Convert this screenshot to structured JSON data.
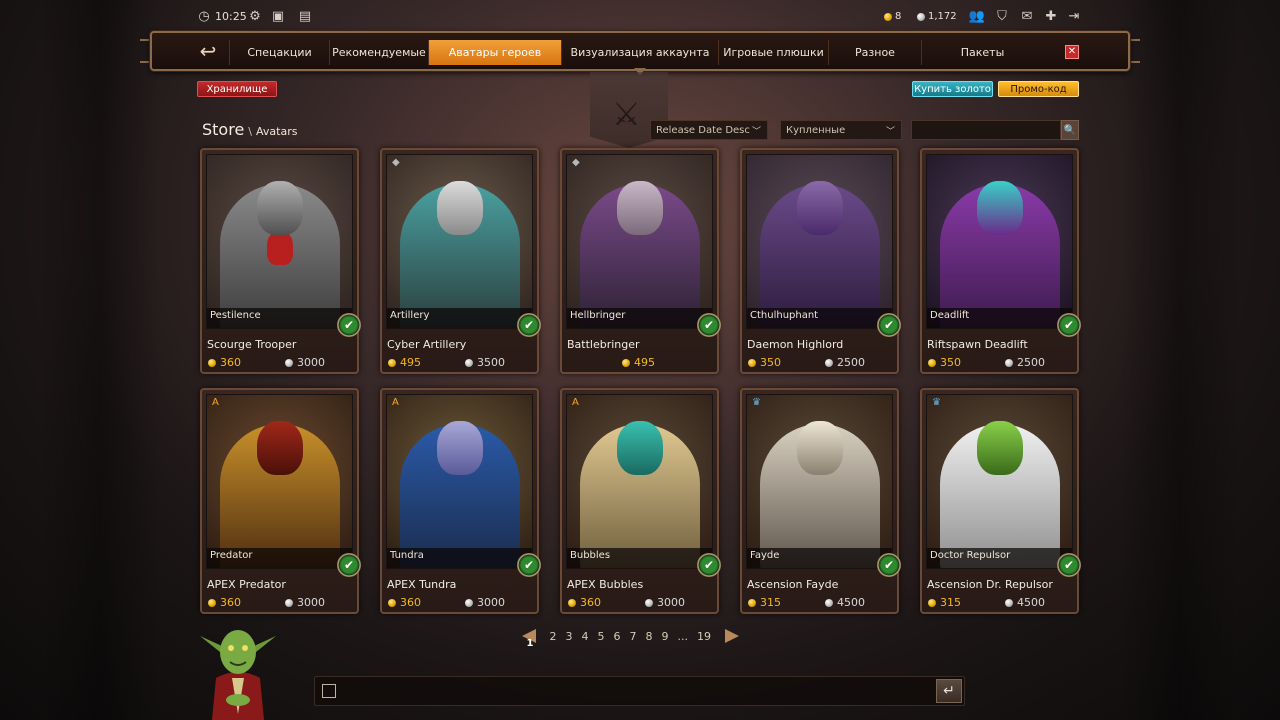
{
  "topbar": {
    "time": "10:25",
    "gold": "8",
    "silver": "1,172",
    "left_icons": [
      "clock-icon",
      "settings-gear-icon",
      "camera-icon",
      "notes-icon"
    ],
    "right_icons": [
      "friends-icon",
      "shield-icon",
      "mail-icon",
      "add-friend-icon",
      "logout-icon"
    ]
  },
  "nav": {
    "tabs": [
      {
        "label": "Спецакции"
      },
      {
        "label": "Рекомендуемые"
      },
      {
        "label": "Аватары героев"
      },
      {
        "label": "Визуализация аккаунта"
      },
      {
        "label": "Игровые плюшки"
      },
      {
        "label": "Разное"
      },
      {
        "label": "Пакеты"
      }
    ],
    "active_tab": "Аватары героев",
    "close": "✕",
    "back": "↩"
  },
  "buttons": {
    "storage": "Хранилище",
    "buy_gold": "Купить золото",
    "promo": "Промо-код"
  },
  "breadcrumb": {
    "store": "Store",
    "sep": "\\",
    "page": "Avatars"
  },
  "filters": {
    "sort": "Release Date Desc",
    "ownership": "Купленные",
    "search_value": ""
  },
  "colors": {
    "accent": "#e48a1e",
    "gold": "#f4b81e",
    "owned_green": "#2f8a2f"
  },
  "cards": [
    {
      "title": "Scourge Trooper",
      "hero": "Pestilence",
      "gold": "360",
      "silver": "3000",
      "owned": true,
      "tier_icon": ""
    },
    {
      "title": "Cyber Artillery",
      "hero": "Artillery",
      "gold": "495",
      "silver": "3500",
      "owned": true,
      "tier_icon": "◆"
    },
    {
      "title": "Battlebringer",
      "hero": "Hellbringer",
      "gold": "495",
      "silver": "",
      "owned": true,
      "tier_icon": "◆"
    },
    {
      "title": "Daemon Highlord",
      "hero": "Cthulhuphant",
      "gold": "350",
      "silver": "2500",
      "owned": true,
      "tier_icon": ""
    },
    {
      "title": "Riftspawn Deadlift",
      "hero": "Deadlift",
      "gold": "350",
      "silver": "2500",
      "owned": true,
      "tier_icon": ""
    },
    {
      "title": "APEX Predator",
      "hero": "Predator",
      "gold": "360",
      "silver": "3000",
      "owned": true,
      "tier_icon": "A"
    },
    {
      "title": "APEX Tundra",
      "hero": "Tundra",
      "gold": "360",
      "silver": "3000",
      "owned": true,
      "tier_icon": "A"
    },
    {
      "title": "APEX Bubbles",
      "hero": "Bubbles",
      "gold": "360",
      "silver": "3000",
      "owned": true,
      "tier_icon": "A"
    },
    {
      "title": "Ascension Fayde",
      "hero": "Fayde",
      "gold": "315",
      "silver": "4500",
      "owned": true,
      "tier_icon": "♛"
    },
    {
      "title": "Ascension Dr. Repulsor",
      "hero": "Doctor Repulsor",
      "gold": "315",
      "silver": "4500",
      "owned": true,
      "tier_icon": "♛"
    }
  ],
  "pagination": {
    "pages": [
      "1",
      "2",
      "3",
      "4",
      "5",
      "6",
      "7",
      "8",
      "9",
      "...",
      "19"
    ],
    "current": "1"
  },
  "chat": {
    "value": ""
  }
}
